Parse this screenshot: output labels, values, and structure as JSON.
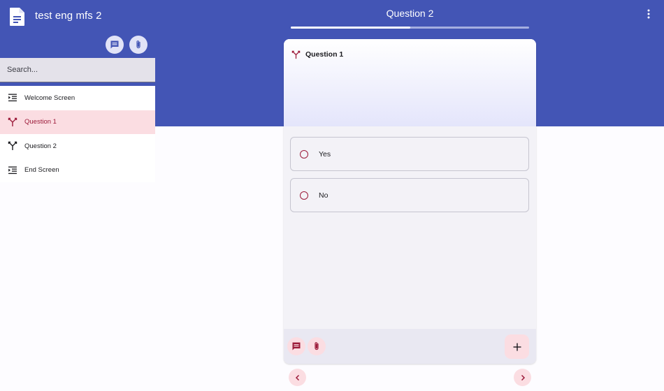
{
  "app": {
    "title": "test eng mfs 2"
  },
  "search": {
    "placeholder": "Search..."
  },
  "sidebar": {
    "items": [
      {
        "label": "Welcome Screen",
        "icon": "screen-icon",
        "active": false
      },
      {
        "label": "Question 1",
        "icon": "branch-icon",
        "active": true
      },
      {
        "label": "Question 2",
        "icon": "branch-icon",
        "active": false
      },
      {
        "label": "End Screen",
        "icon": "screen-icon",
        "active": false
      }
    ]
  },
  "main": {
    "title": "Question 2",
    "progress": 0.5,
    "card": {
      "question": "Question 1",
      "options": [
        "Yes",
        "No"
      ]
    }
  },
  "colors": {
    "header": "#4355b5",
    "accent": "#9c1b3a",
    "active_bg": "#fbdde2",
    "card_bg": "#f3f2f7"
  }
}
